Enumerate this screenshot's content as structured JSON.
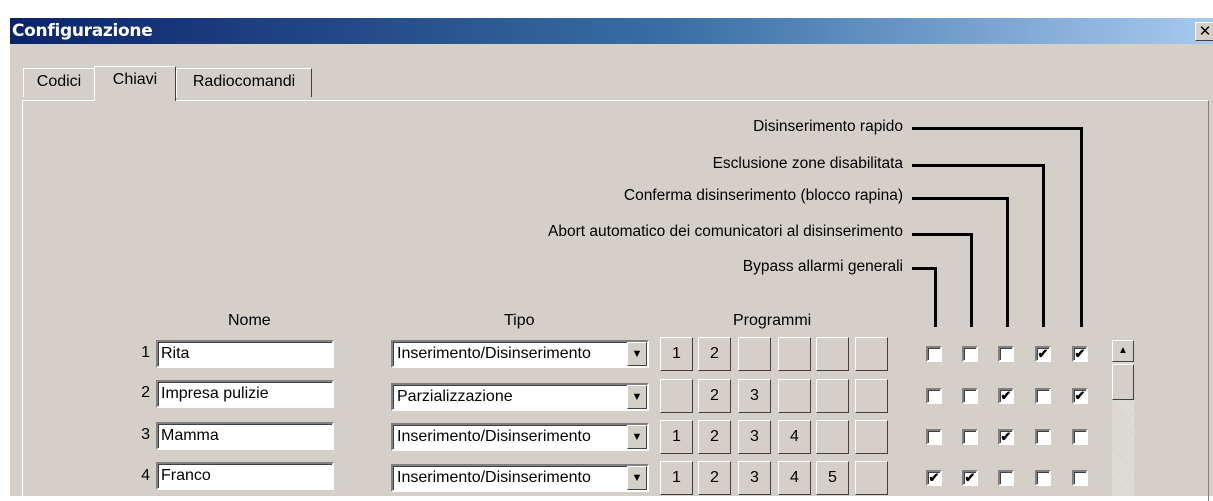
{
  "window": {
    "title": "Configurazione",
    "close_label": "✕"
  },
  "tabs": [
    {
      "label": "Codici",
      "active": false
    },
    {
      "label": "Chiavi",
      "active": true
    },
    {
      "label": "Radiocomandi",
      "active": false
    }
  ],
  "options": [
    "Disinserimento rapido",
    "Esclusione zone disabilitata",
    "Conferma disinserimento (blocco rapina)",
    "Abort automatico dei comunicatori al disinserimento",
    "Bypass allarmi  generali"
  ],
  "headers": {
    "nome": "Nome",
    "tipo": "Tipo",
    "programmi": "Programmi"
  },
  "rows": [
    {
      "num": "1",
      "nome": "Rita",
      "tipo": "Inserimento/Disinserimento",
      "programmi": [
        "1",
        "2",
        "",
        "",
        "",
        ""
      ],
      "checks": [
        "",
        "",
        "",
        "✔",
        "✔"
      ]
    },
    {
      "num": "2",
      "nome": "Impresa pulizie",
      "tipo": "Parzializzazione",
      "programmi": [
        "",
        "2",
        "3",
        "",
        "",
        ""
      ],
      "checks": [
        "",
        "",
        "✔",
        "",
        "✔"
      ]
    },
    {
      "num": "3",
      "nome": "Mamma",
      "tipo": "Inserimento/Disinserimento",
      "programmi": [
        "1",
        "2",
        "3",
        "4",
        "",
        ""
      ],
      "checks": [
        "",
        "",
        "✔",
        "",
        ""
      ]
    },
    {
      "num": "4",
      "nome": "Franco",
      "tipo": "Inserimento/Disinserimento",
      "programmi": [
        "1",
        "2",
        "3",
        "4",
        "5",
        ""
      ],
      "checks": [
        "✔",
        "✔",
        "",
        "",
        ""
      ]
    }
  ],
  "icons": {
    "dropdown": "chevron-down-icon",
    "scroll_up": "arrow-up-icon"
  },
  "scroll_glyph": "▲",
  "dropdown_glyph": "▼"
}
